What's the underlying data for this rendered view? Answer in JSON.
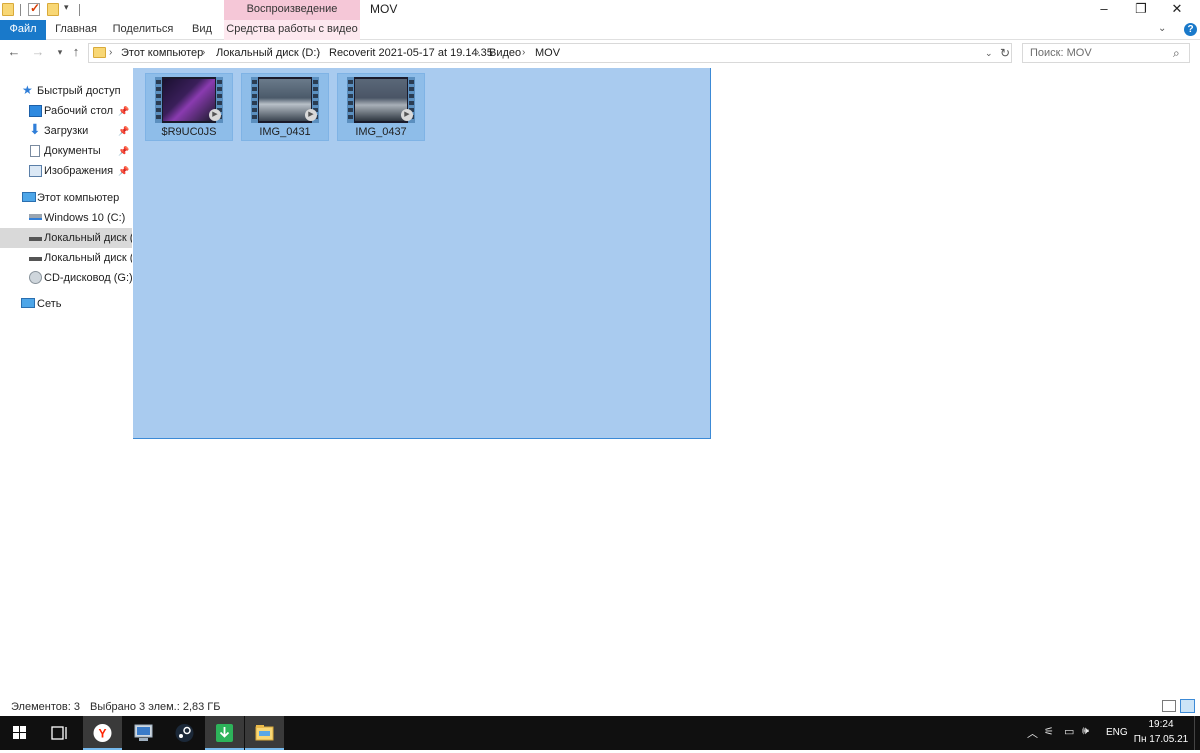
{
  "window": {
    "title": "MOV",
    "contextual_group": "Воспроизведение",
    "minimize_icon": "minimize-icon",
    "restore_icon": "restore-icon",
    "close_icon": "close-icon"
  },
  "ribbon": {
    "tabs": [
      {
        "label": "Файл"
      },
      {
        "label": "Главная"
      },
      {
        "label": "Поделиться"
      },
      {
        "label": "Вид"
      },
      {
        "label": "Средства работы с видео"
      }
    ],
    "help_label": "?"
  },
  "address": {
    "crumbs": [
      "Этот компьютер",
      "Локальный диск (D:)",
      "Recoverit 2021-05-17 at 19.14.35",
      "Видео",
      "MOV"
    ]
  },
  "search": {
    "placeholder": "Поиск: MOV"
  },
  "nav": {
    "items": [
      {
        "label": "Быстрый доступ",
        "icon": "star-icon"
      },
      {
        "label": "Рабочий стол",
        "icon": "desktop-icon",
        "pinned": true
      },
      {
        "label": "Загрузки",
        "icon": "download-icon",
        "pinned": true
      },
      {
        "label": "Документы",
        "icon": "documents-icon",
        "pinned": true
      },
      {
        "label": "Изображения",
        "icon": "pictures-icon",
        "pinned": true
      },
      {
        "label": "Этот компьютер",
        "icon": "computer-icon"
      },
      {
        "label": "Windows 10 (C:)",
        "icon": "windows-drive-icon"
      },
      {
        "label": "Локальный диск (D",
        "icon": "drive-icon",
        "selected": true
      },
      {
        "label": "Локальный диск (E",
        "icon": "drive-icon"
      },
      {
        "label": "CD-дисковод (G:)",
        "icon": "cd-drive-icon"
      },
      {
        "label": "Сеть",
        "icon": "network-icon"
      }
    ]
  },
  "files": [
    {
      "name": "$R9UC0JS",
      "thumb_color": "#3a1f5a"
    },
    {
      "name": "IMG_0431",
      "thumb_color": "#4b5a6a"
    },
    {
      "name": "IMG_0437",
      "thumb_color": "#4a5566"
    }
  ],
  "status": {
    "count": "Элементов: 3",
    "selected": "Выбрано 3 элем.: 2,83 ГБ"
  },
  "taskbar": {
    "apps": [
      "windows-start-icon",
      "task-view-icon",
      "yandex-browser-icon",
      "computer-app-icon",
      "steam-icon",
      "download-app-icon",
      "file-explorer-icon"
    ],
    "lang": "ENG",
    "time": "19:24",
    "date": "Пн 17.05.21"
  },
  "colors": {
    "accent": "#1979ca",
    "selection": "#a9cbef",
    "contextual": "#f5c7d7"
  }
}
